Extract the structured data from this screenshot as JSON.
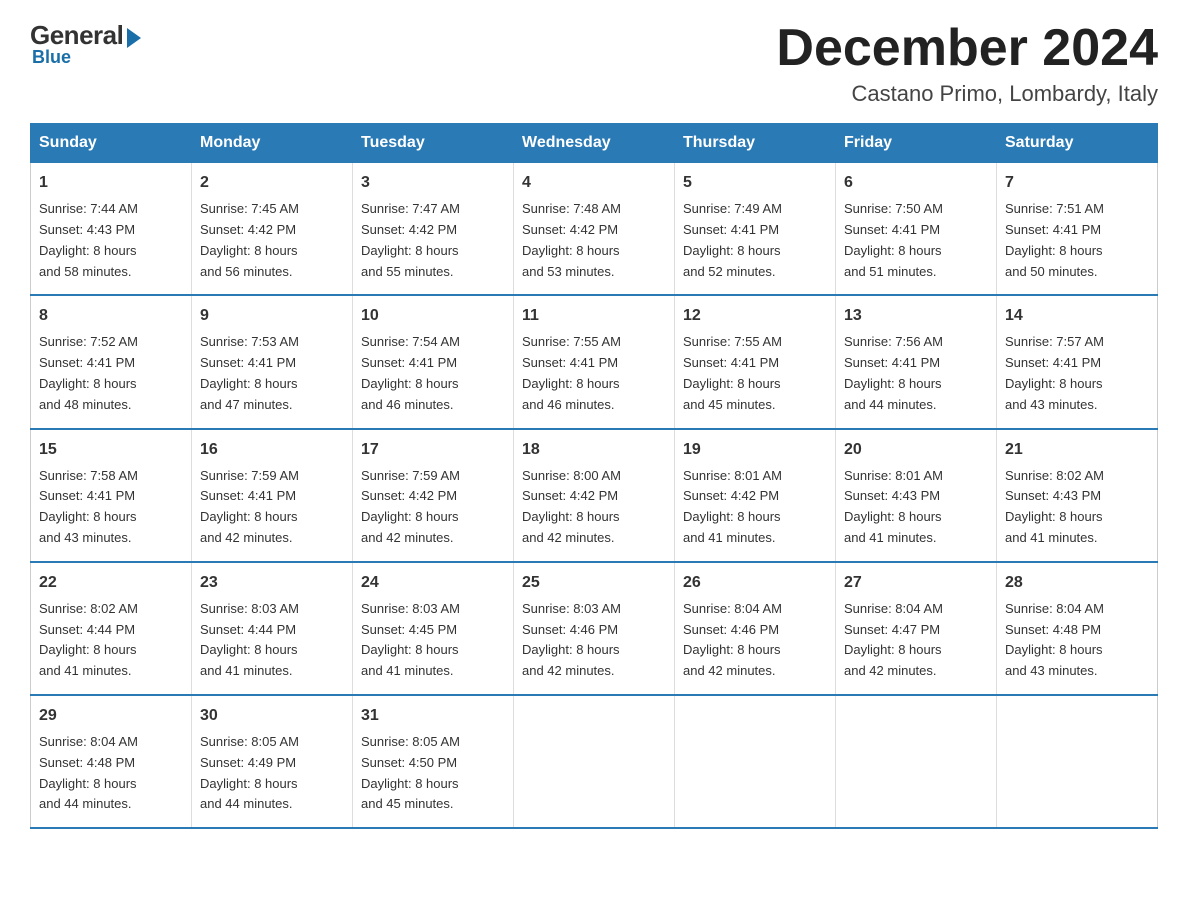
{
  "header": {
    "logo": {
      "general": "General",
      "blue": "Blue"
    },
    "title": "December 2024",
    "subtitle": "Castano Primo, Lombardy, Italy"
  },
  "days_of_week": [
    "Sunday",
    "Monday",
    "Tuesday",
    "Wednesday",
    "Thursday",
    "Friday",
    "Saturday"
  ],
  "weeks": [
    [
      {
        "day": "1",
        "sunrise": "7:44 AM",
        "sunset": "4:43 PM",
        "daylight": "8 hours and 58 minutes."
      },
      {
        "day": "2",
        "sunrise": "7:45 AM",
        "sunset": "4:42 PM",
        "daylight": "8 hours and 56 minutes."
      },
      {
        "day": "3",
        "sunrise": "7:47 AM",
        "sunset": "4:42 PM",
        "daylight": "8 hours and 55 minutes."
      },
      {
        "day": "4",
        "sunrise": "7:48 AM",
        "sunset": "4:42 PM",
        "daylight": "8 hours and 53 minutes."
      },
      {
        "day": "5",
        "sunrise": "7:49 AM",
        "sunset": "4:41 PM",
        "daylight": "8 hours and 52 minutes."
      },
      {
        "day": "6",
        "sunrise": "7:50 AM",
        "sunset": "4:41 PM",
        "daylight": "8 hours and 51 minutes."
      },
      {
        "day": "7",
        "sunrise": "7:51 AM",
        "sunset": "4:41 PM",
        "daylight": "8 hours and 50 minutes."
      }
    ],
    [
      {
        "day": "8",
        "sunrise": "7:52 AM",
        "sunset": "4:41 PM",
        "daylight": "8 hours and 48 minutes."
      },
      {
        "day": "9",
        "sunrise": "7:53 AM",
        "sunset": "4:41 PM",
        "daylight": "8 hours and 47 minutes."
      },
      {
        "day": "10",
        "sunrise": "7:54 AM",
        "sunset": "4:41 PM",
        "daylight": "8 hours and 46 minutes."
      },
      {
        "day": "11",
        "sunrise": "7:55 AM",
        "sunset": "4:41 PM",
        "daylight": "8 hours and 46 minutes."
      },
      {
        "day": "12",
        "sunrise": "7:55 AM",
        "sunset": "4:41 PM",
        "daylight": "8 hours and 45 minutes."
      },
      {
        "day": "13",
        "sunrise": "7:56 AM",
        "sunset": "4:41 PM",
        "daylight": "8 hours and 44 minutes."
      },
      {
        "day": "14",
        "sunrise": "7:57 AM",
        "sunset": "4:41 PM",
        "daylight": "8 hours and 43 minutes."
      }
    ],
    [
      {
        "day": "15",
        "sunrise": "7:58 AM",
        "sunset": "4:41 PM",
        "daylight": "8 hours and 43 minutes."
      },
      {
        "day": "16",
        "sunrise": "7:59 AM",
        "sunset": "4:41 PM",
        "daylight": "8 hours and 42 minutes."
      },
      {
        "day": "17",
        "sunrise": "7:59 AM",
        "sunset": "4:42 PM",
        "daylight": "8 hours and 42 minutes."
      },
      {
        "day": "18",
        "sunrise": "8:00 AM",
        "sunset": "4:42 PM",
        "daylight": "8 hours and 42 minutes."
      },
      {
        "day": "19",
        "sunrise": "8:01 AM",
        "sunset": "4:42 PM",
        "daylight": "8 hours and 41 minutes."
      },
      {
        "day": "20",
        "sunrise": "8:01 AM",
        "sunset": "4:43 PM",
        "daylight": "8 hours and 41 minutes."
      },
      {
        "day": "21",
        "sunrise": "8:02 AM",
        "sunset": "4:43 PM",
        "daylight": "8 hours and 41 minutes."
      }
    ],
    [
      {
        "day": "22",
        "sunrise": "8:02 AM",
        "sunset": "4:44 PM",
        "daylight": "8 hours and 41 minutes."
      },
      {
        "day": "23",
        "sunrise": "8:03 AM",
        "sunset": "4:44 PM",
        "daylight": "8 hours and 41 minutes."
      },
      {
        "day": "24",
        "sunrise": "8:03 AM",
        "sunset": "4:45 PM",
        "daylight": "8 hours and 41 minutes."
      },
      {
        "day": "25",
        "sunrise": "8:03 AM",
        "sunset": "4:46 PM",
        "daylight": "8 hours and 42 minutes."
      },
      {
        "day": "26",
        "sunrise": "8:04 AM",
        "sunset": "4:46 PM",
        "daylight": "8 hours and 42 minutes."
      },
      {
        "day": "27",
        "sunrise": "8:04 AM",
        "sunset": "4:47 PM",
        "daylight": "8 hours and 42 minutes."
      },
      {
        "day": "28",
        "sunrise": "8:04 AM",
        "sunset": "4:48 PM",
        "daylight": "8 hours and 43 minutes."
      }
    ],
    [
      {
        "day": "29",
        "sunrise": "8:04 AM",
        "sunset": "4:48 PM",
        "daylight": "8 hours and 44 minutes."
      },
      {
        "day": "30",
        "sunrise": "8:05 AM",
        "sunset": "4:49 PM",
        "daylight": "8 hours and 44 minutes."
      },
      {
        "day": "31",
        "sunrise": "8:05 AM",
        "sunset": "4:50 PM",
        "daylight": "8 hours and 45 minutes."
      },
      {
        "day": "",
        "sunrise": "",
        "sunset": "",
        "daylight": ""
      },
      {
        "day": "",
        "sunrise": "",
        "sunset": "",
        "daylight": ""
      },
      {
        "day": "",
        "sunrise": "",
        "sunset": "",
        "daylight": ""
      },
      {
        "day": "",
        "sunrise": "",
        "sunset": "",
        "daylight": ""
      }
    ]
  ]
}
